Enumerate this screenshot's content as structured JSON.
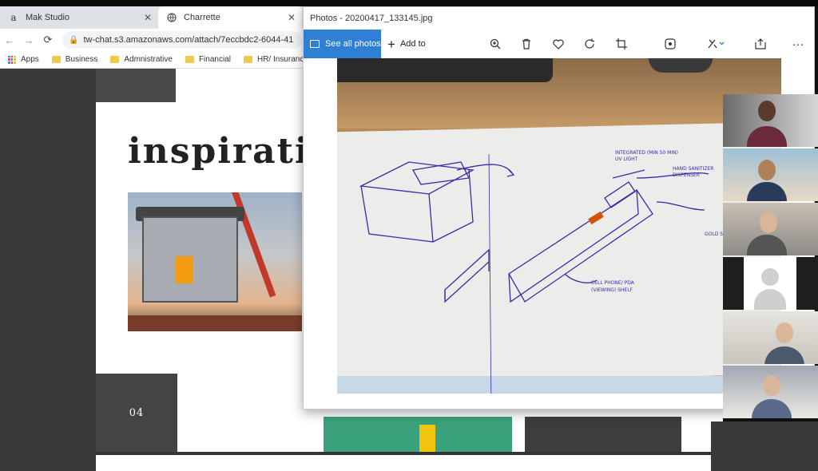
{
  "browser": {
    "tabs": [
      {
        "label": "Mak Studio",
        "icon": "amazon-icon"
      },
      {
        "label": "Charrette",
        "icon": "globe-icon"
      }
    ],
    "url": "tw-chat.s3.amazonaws.com/attach/7eccbdc2-6044-41",
    "bookmarks": [
      "Apps",
      "Business",
      "Admnistrative",
      "Financial",
      "HR/ Insurance"
    ]
  },
  "slide": {
    "title": "inspiratio",
    "page_number": "04"
  },
  "photos_app": {
    "window_title": "Photos - 20200417_133145.jpg",
    "see_all_label": "See all photos",
    "add_to_label": "Add to",
    "toolbar_icons": [
      "zoom-icon",
      "delete-icon",
      "heart-icon",
      "rotate-icon",
      "crop-icon",
      "enhance-icon",
      "edit-icon",
      "share-icon",
      "more-icon"
    ],
    "sketch_annotations": [
      "INTEGRATED (MIN 50 MIN)",
      "UV LIGHT",
      "HAND SANITIZER",
      "DISPENSER",
      "GOLD SURFACE",
      "CELL PHONE/ PDA",
      "(VIEWING) SHELF"
    ]
  },
  "participants": [
    {
      "type": "video"
    },
    {
      "type": "video"
    },
    {
      "type": "video"
    },
    {
      "type": "avatar"
    },
    {
      "type": "video"
    },
    {
      "type": "video"
    }
  ]
}
